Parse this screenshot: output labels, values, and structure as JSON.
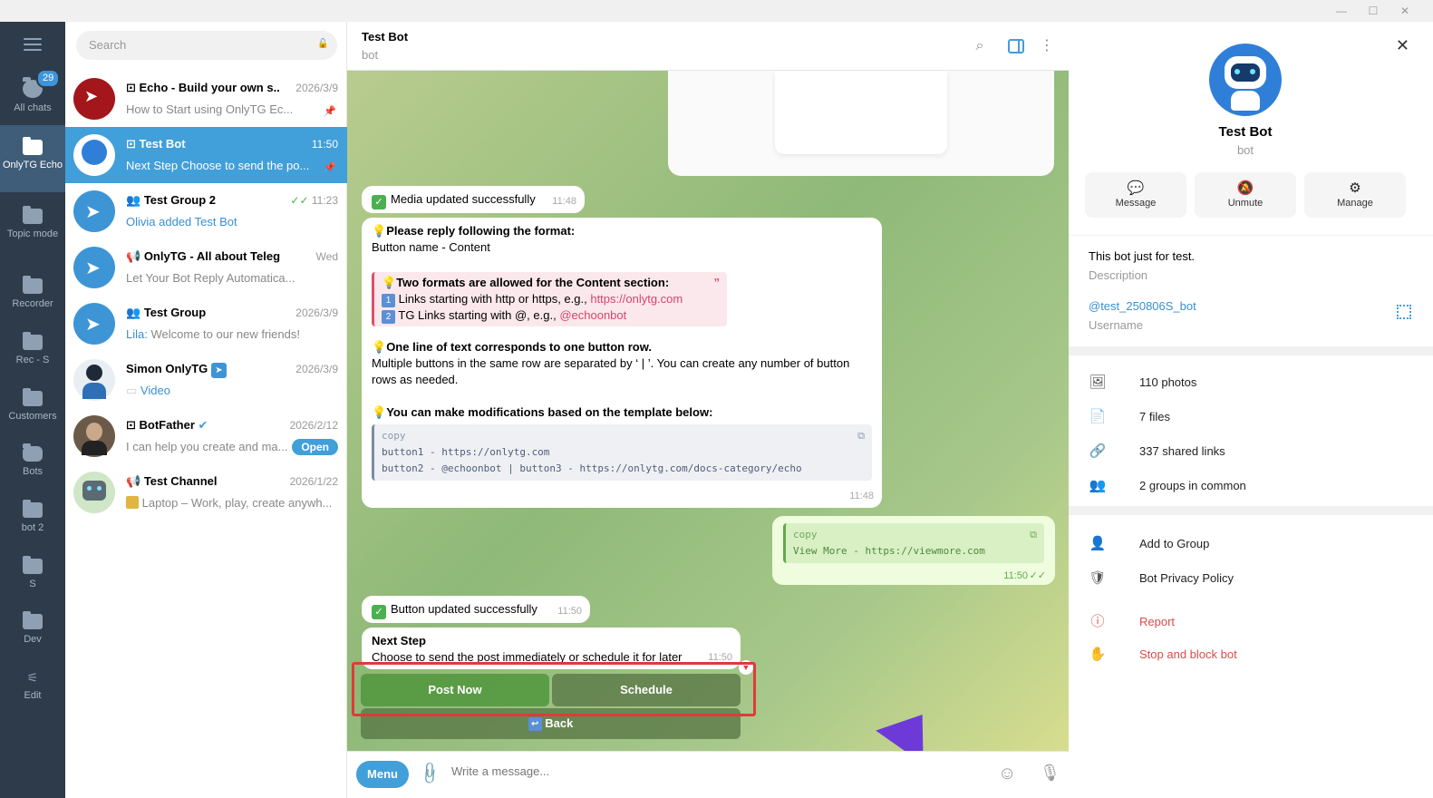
{
  "window": {
    "minimize": "—",
    "maximize": "☐",
    "close": "✕"
  },
  "folders": [
    {
      "label": "All chats",
      "badge": "29"
    },
    {
      "label": "OnlyTG Echo"
    },
    {
      "label": "Topic mode"
    },
    {
      "label": "Recorder"
    },
    {
      "label": "Rec - S"
    },
    {
      "label": "Customers"
    },
    {
      "label": "Bots"
    },
    {
      "label": "bot 2"
    },
    {
      "label": "S"
    },
    {
      "label": "Dev"
    },
    {
      "label": "Edit"
    }
  ],
  "search": {
    "placeholder": "Search"
  },
  "chats": [
    {
      "title": "Echo - Build your own s...",
      "time": "2026/3/9",
      "preview": "How to Start using OnlyTG Ec...",
      "icon": "bot-icon"
    },
    {
      "title": "Test Bot",
      "time": "11:50",
      "preview": "Next Step Choose to send the po...",
      "icon": "bot-icon"
    },
    {
      "title": "Test Group 2",
      "time": "11:23",
      "preview": "Olivia added Test Bot",
      "icon": "group-icon"
    },
    {
      "title": "OnlyTG - All about Telegram",
      "time": "Wed",
      "preview": "Let Your Bot Reply Automatica...",
      "icon": "channel-icon"
    },
    {
      "title": "Test Group",
      "time": "2026/3/9",
      "preview_sender": "Lila:",
      "preview": "Welcome to our new friends!",
      "icon": "group-icon"
    },
    {
      "title": "Simon OnlyTG",
      "time": "2026/3/9",
      "preview": "Video"
    },
    {
      "title": "BotFather",
      "time": "2026/2/12",
      "preview": "I can help you create and ma...",
      "action": "Open",
      "icon": "bot-icon"
    },
    {
      "title": "Test Channel",
      "time": "2026/1/22",
      "preview": "Laptop – Work, play, create anywh...",
      "icon": "channel-icon"
    }
  ],
  "header": {
    "title": "Test Bot",
    "subtitle": "bot"
  },
  "messages": {
    "media_updated": {
      "text": "Media updated successfully",
      "time": "11:48"
    },
    "format": {
      "line1": "Please reply following the format:",
      "line2": "Button name - Content",
      "quote_title": "Two formats are allowed for the Content section:",
      "quote_1": "Links starting with http or https, e.g., ",
      "quote_1_link": "https://onlytg.com",
      "quote_2": "TG Links starting with @, e.g., ",
      "quote_2_link": "@echoonbot",
      "row_title": "One line of text corresponds to one button row.",
      "row_text": "Multiple buttons in the same row are separated by ‘ | ’. You can create any number of button rows as needed.",
      "template_title": "You can make modifications based on the template below:",
      "code_label": "copy",
      "code_1": "button1 - https://onlytg.com",
      "code_2": "button2 - @echoonbot | button3 - https://onlytg.com/docs-category/echo",
      "time": "11:48"
    },
    "outgoing": {
      "code_label": "copy",
      "code": "View More - https://viewmore.com",
      "time": "11:50"
    },
    "button_updated": {
      "text": "Button updated successfully",
      "time": "11:50"
    },
    "next_step": {
      "title": "Next Step",
      "text": "Choose to send the post immediately or schedule it for later",
      "time": "11:50"
    }
  },
  "keyboard": {
    "post_now": "Post Now",
    "schedule": "Schedule",
    "back": "Back"
  },
  "composer": {
    "menu": "Menu",
    "placeholder": "Write a message..."
  },
  "profile": {
    "name": "Test Bot",
    "status": "bot",
    "actions": [
      "Message",
      "Unmute",
      "Manage"
    ],
    "description": "This bot just for test.",
    "description_label": "Description",
    "username": "@test_250806S_bot",
    "username_label": "Username",
    "media": [
      "110 photos",
      "7 files",
      "337 shared links",
      "2 groups in common"
    ],
    "links": [
      "Add to Group",
      "Bot Privacy Policy"
    ],
    "danger": [
      "Report",
      "Stop and block bot"
    ]
  },
  "colors": {
    "accent": "#419fd9",
    "rail": "#2e3b4b",
    "danger": "#d94c4c"
  }
}
